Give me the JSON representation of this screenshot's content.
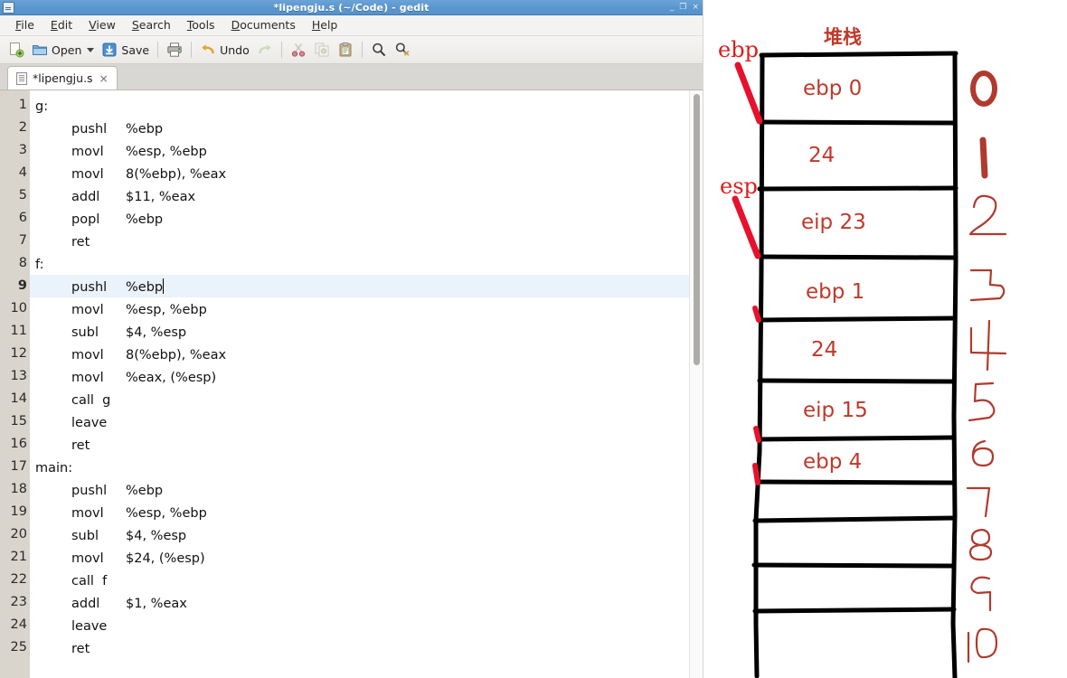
{
  "window": {
    "title": "*lipengju.s (~/Code) - gedit",
    "minimize_label": "_",
    "maximize_label": "❐",
    "close_label": "×"
  },
  "menu": {
    "items": [
      {
        "label": "File",
        "mnemonic": "F",
        "rest": "ile"
      },
      {
        "label": "Edit",
        "mnemonic": "E",
        "rest": "dit"
      },
      {
        "label": "View",
        "mnemonic": "V",
        "rest": "iew"
      },
      {
        "label": "Search",
        "mnemonic": "S",
        "rest": "earch"
      },
      {
        "label": "Tools",
        "mnemonic": "T",
        "rest": "ools"
      },
      {
        "label": "Documents",
        "mnemonic": "D",
        "rest": "ocuments"
      },
      {
        "label": "Help",
        "mnemonic": "H",
        "rest": "elp"
      }
    ]
  },
  "toolbar": {
    "new_icon": "new-document-icon",
    "open_label": "Open",
    "open_icon": "folder-icon",
    "open_dropdown_icon": "chevron-down-icon",
    "save_label": "Save",
    "save_icon": "save-icon",
    "print_icon": "printer-icon",
    "undo_label": "Undo",
    "undo_icon": "undo-arrow-icon",
    "redo_icon": "redo-arrow-icon",
    "cut_icon": "scissors-icon",
    "copy_icon": "copy-icon",
    "paste_icon": "clipboard-icon",
    "find_icon": "magnifier-icon",
    "replace_icon": "find-replace-icon"
  },
  "tab": {
    "label": "*lipengju.s",
    "close_label": "×",
    "doc_icon": "document-icon"
  },
  "editor": {
    "current_line": 9,
    "lines": [
      {
        "n": 1,
        "mnemonic": "g:",
        "operands": ""
      },
      {
        "n": 2,
        "mnemonic": "pushl",
        "operands": "%ebp"
      },
      {
        "n": 3,
        "mnemonic": "movl",
        "operands": "%esp, %ebp"
      },
      {
        "n": 4,
        "mnemonic": "movl",
        "operands": "8(%ebp), %eax"
      },
      {
        "n": 5,
        "mnemonic": "addl",
        "operands": "$11, %eax"
      },
      {
        "n": 6,
        "mnemonic": "popl",
        "operands": "%ebp"
      },
      {
        "n": 7,
        "mnemonic": "ret",
        "operands": ""
      },
      {
        "n": 8,
        "mnemonic": "f:",
        "operands": ""
      },
      {
        "n": 9,
        "mnemonic": "pushl",
        "operands": "%ebp"
      },
      {
        "n": 10,
        "mnemonic": "movl",
        "operands": "%esp, %ebp"
      },
      {
        "n": 11,
        "mnemonic": "subl",
        "operands": "$4, %esp"
      },
      {
        "n": 12,
        "mnemonic": "movl",
        "operands": "8(%ebp), %eax"
      },
      {
        "n": 13,
        "mnemonic": "movl",
        "operands": "%eax, (%esp)"
      },
      {
        "n": 14,
        "mnemonic": "call  g",
        "operands": ""
      },
      {
        "n": 15,
        "mnemonic": "leave",
        "operands": ""
      },
      {
        "n": 16,
        "mnemonic": "ret",
        "operands": ""
      },
      {
        "n": 17,
        "mnemonic": "main:",
        "operands": ""
      },
      {
        "n": 18,
        "mnemonic": "pushl",
        "operands": "%ebp"
      },
      {
        "n": 19,
        "mnemonic": "movl",
        "operands": "%esp, %ebp"
      },
      {
        "n": 20,
        "mnemonic": "subl",
        "operands": "$4, %esp"
      },
      {
        "n": 21,
        "mnemonic": "movl",
        "operands": "$24, (%esp)"
      },
      {
        "n": 22,
        "mnemonic": "call  f",
        "operands": ""
      },
      {
        "n": 23,
        "mnemonic": "addl",
        "operands": "$1, %eax"
      },
      {
        "n": 24,
        "mnemonic": "leave",
        "operands": ""
      },
      {
        "n": 25,
        "mnemonic": "ret",
        "operands": ""
      }
    ]
  },
  "diagram": {
    "title": "堆栈",
    "pointer_labels": [
      {
        "name": "ebp",
        "text": "ebp"
      },
      {
        "name": "esp",
        "text": "esp"
      }
    ],
    "cells": [
      {
        "index": 0,
        "text": "ebp 0"
      },
      {
        "index": 1,
        "text": "24"
      },
      {
        "index": 2,
        "text": "eip 23"
      },
      {
        "index": 3,
        "text": "ebp 1"
      },
      {
        "index": 4,
        "text": "24"
      },
      {
        "index": 5,
        "text": "eip 15"
      },
      {
        "index": 6,
        "text": "ebp 4"
      },
      {
        "index": 7,
        "text": ""
      },
      {
        "index": 8,
        "text": ""
      },
      {
        "index": 9,
        "text": ""
      },
      {
        "index": 10,
        "text": ""
      }
    ],
    "row_numbers": [
      "0",
      "1",
      "2",
      "3",
      "4",
      "5",
      "6",
      "7",
      "8",
      "9",
      "10"
    ],
    "colors": {
      "ink_red": "#c0392b",
      "marker_red": "#e11b1b",
      "ink_black": "#000000"
    }
  }
}
